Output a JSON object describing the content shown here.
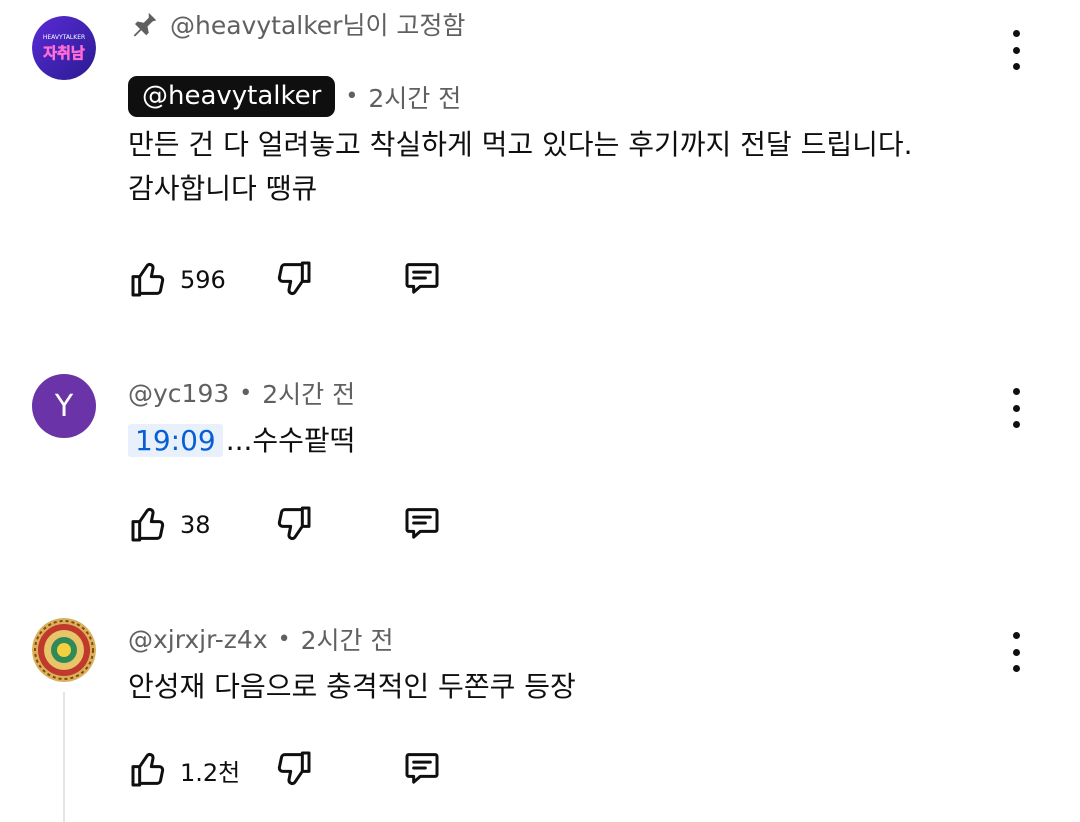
{
  "comments": [
    {
      "pinned_label": "@heavytalker님이 고정함",
      "author": "@heavytalker",
      "time": "2시간 전",
      "text_line1": "만든 건 다 얼려놓고 착실하게 먹고 있다는 후기까지 전달 드립니다.",
      "text_line2": "감사합니다 땡큐",
      "likes": "596",
      "avatar_text_top": "HEAVYTALKER",
      "avatar_text_main": "자취남"
    },
    {
      "author": "@yc193",
      "time": "2시간 전",
      "avatar_letter": "Y",
      "timestamp_link": "19:09",
      "text_rest": "...수수팥떡",
      "likes": "38"
    },
    {
      "author": "@xjrxjr-z4x",
      "time": "2시간 전",
      "text": "안성재 다음으로 충격적인 두쫀쿠 등장",
      "likes": "1.2천"
    }
  ],
  "separator": "•",
  "icons": {
    "pin": "pin-icon",
    "like": "thumbs-up-icon",
    "dislike": "thumbs-down-icon",
    "reply": "reply-comment-icon",
    "menu": "more-vertical-icon"
  },
  "colors": {
    "pill_bg": "#0f0f0f",
    "timestamp_link": "#065fd4",
    "timestamp_bg": "#e8f0fb",
    "letter_avatar": "#6a33a8"
  }
}
